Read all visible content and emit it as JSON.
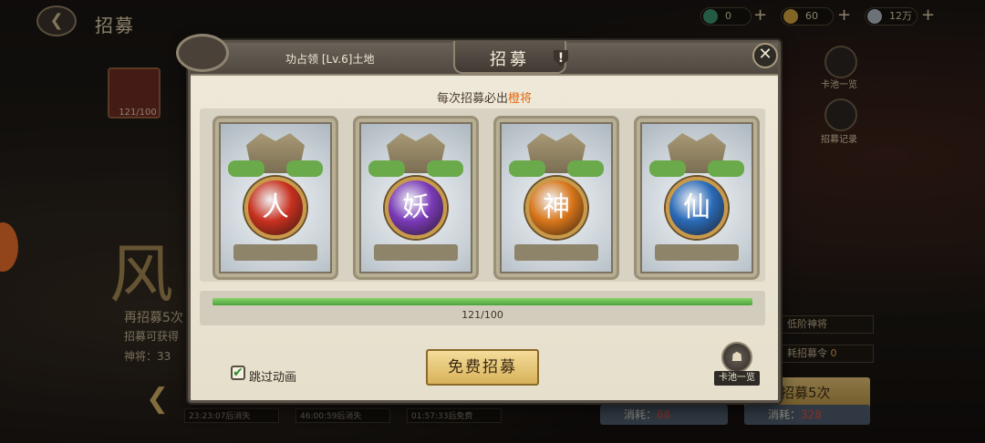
{
  "background": {
    "page_title": "招募",
    "resources": [
      {
        "icon": "jade-coin-icon",
        "value": "0"
      },
      {
        "icon": "recruit-token-icon",
        "value": "60"
      },
      {
        "icon": "silver-icon",
        "value": "12万"
      }
    ],
    "left_card_count": "121/100",
    "big_character": "风",
    "recruit_hint": "再招募5次",
    "recruit_obtain": "招募可获得",
    "god_general": "神将：33",
    "timers": [
      "23:23:07后消失",
      "46:00:59后消失",
      "01:57:33后免费"
    ],
    "side_buttons": {
      "pool": "卡池一览",
      "record": "招募记录"
    },
    "low_tier_label": "低阶神将",
    "consume_token_label": "耗招募令",
    "consume_token_value": "0",
    "recruit_5x": "招募5次",
    "costs": [
      {
        "label": "消耗：",
        "value": "68"
      },
      {
        "label": "消耗：",
        "value": "328"
      }
    ]
  },
  "modal": {
    "region": "功占领 [Lv.6]土地",
    "title": "招募",
    "subtitle_prefix": "每次招募必出",
    "subtitle_highlight": "橙将",
    "cards": [
      {
        "symbol": "人",
        "color": "#c8301e"
      },
      {
        "symbol": "妖",
        "color": "#7a3ab8"
      },
      {
        "symbol": "神",
        "color": "#d8761a"
      },
      {
        "symbol": "仙",
        "color": "#2a6ab8"
      }
    ],
    "progress_current": 121,
    "progress_max": 100,
    "progress_text": "121/100",
    "skip_animation_label": "跳过动画",
    "skip_animation_checked": true,
    "free_recruit_label": "免费招募",
    "pool_list_label": "卡池一览",
    "colors": {
      "accent_orange": "#e06a14",
      "progress_green": "#4aa23a"
    }
  }
}
